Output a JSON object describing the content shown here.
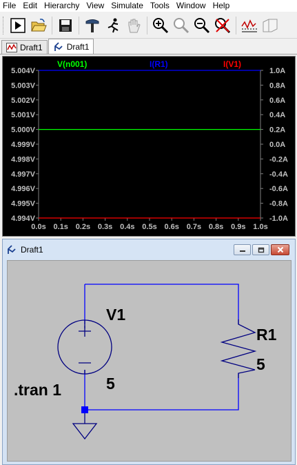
{
  "menu": [
    "File",
    "Edit",
    "Hierarchy",
    "View",
    "Simulate",
    "Tools",
    "Window",
    "Help"
  ],
  "toolbar_icons": [
    "run-icon",
    "open-folder-icon",
    "save-icon",
    "control-panel-hammer-icon",
    "halt-runner-icon",
    "pan-hand-icon",
    "zoom-in-icon",
    "zoom-area-icon",
    "zoom-out-icon",
    "zoom-cancel-icon",
    "autorange-icon",
    "dock-window-icon"
  ],
  "tabs": [
    {
      "label": "Draft1",
      "icon": "waveform-icon"
    },
    {
      "label": "Draft1",
      "icon": "schematic-icon"
    }
  ],
  "plot": {
    "traces": [
      {
        "label": "V(n001)",
        "color": "#00ff00"
      },
      {
        "label": "I(R1)",
        "color": "#0000ff"
      },
      {
        "label": "I(V1)",
        "color": "#ff0000"
      }
    ],
    "left_axis_ticks": [
      "5.004V",
      "5.003V",
      "5.002V",
      "5.001V",
      "5.000V",
      "4.999V",
      "4.998V",
      "4.997V",
      "4.996V",
      "4.995V",
      "4.994V"
    ],
    "right_axis_ticks": [
      "1.0A",
      "0.8A",
      "0.6A",
      "0.4A",
      "0.2A",
      "0.0A",
      "-0.2A",
      "-0.4A",
      "-0.6A",
      "-0.8A",
      "-1.0A"
    ],
    "x_axis_ticks": [
      "0.0s",
      "0.1s",
      "0.2s",
      "0.3s",
      "0.4s",
      "0.5s",
      "0.6s",
      "0.7s",
      "0.8s",
      "0.9s",
      "1.0s"
    ],
    "colors": {
      "background": "#000000",
      "axis_text": "#c0c0c0",
      "grid": "#808080"
    }
  },
  "chart_data": {
    "type": "line",
    "x": [
      0.0,
      1.0
    ],
    "xlim": [
      0.0,
      1.0
    ],
    "ylim_left": [
      4.994,
      5.004
    ],
    "ylim_right": [
      -1.0,
      1.0
    ],
    "series": [
      {
        "name": "V(n001)",
        "axis": "left",
        "values": [
          5.0,
          5.0
        ],
        "color": "#00ff00"
      },
      {
        "name": "I(R1)",
        "axis": "right",
        "values": [
          1.0,
          1.0
        ],
        "color": "#0000ff"
      },
      {
        "name": "I(V1)",
        "axis": "right",
        "values": [
          -1.0,
          -1.0
        ],
        "color": "#ff0000"
      }
    ],
    "grid": false
  },
  "schematic_window": {
    "title": "Draft1",
    "icon": "schematic-icon",
    "buttons": [
      "minimize",
      "restore",
      "close"
    ],
    "labels": {
      "source_name": "V1",
      "source_value": "5",
      "resistor_name": "R1",
      "resistor_value": "5",
      "directive": ".tran 1"
    },
    "colors": {
      "wire": "#0000ff",
      "component": "#000080",
      "canvas": "#c0c0c0"
    }
  }
}
